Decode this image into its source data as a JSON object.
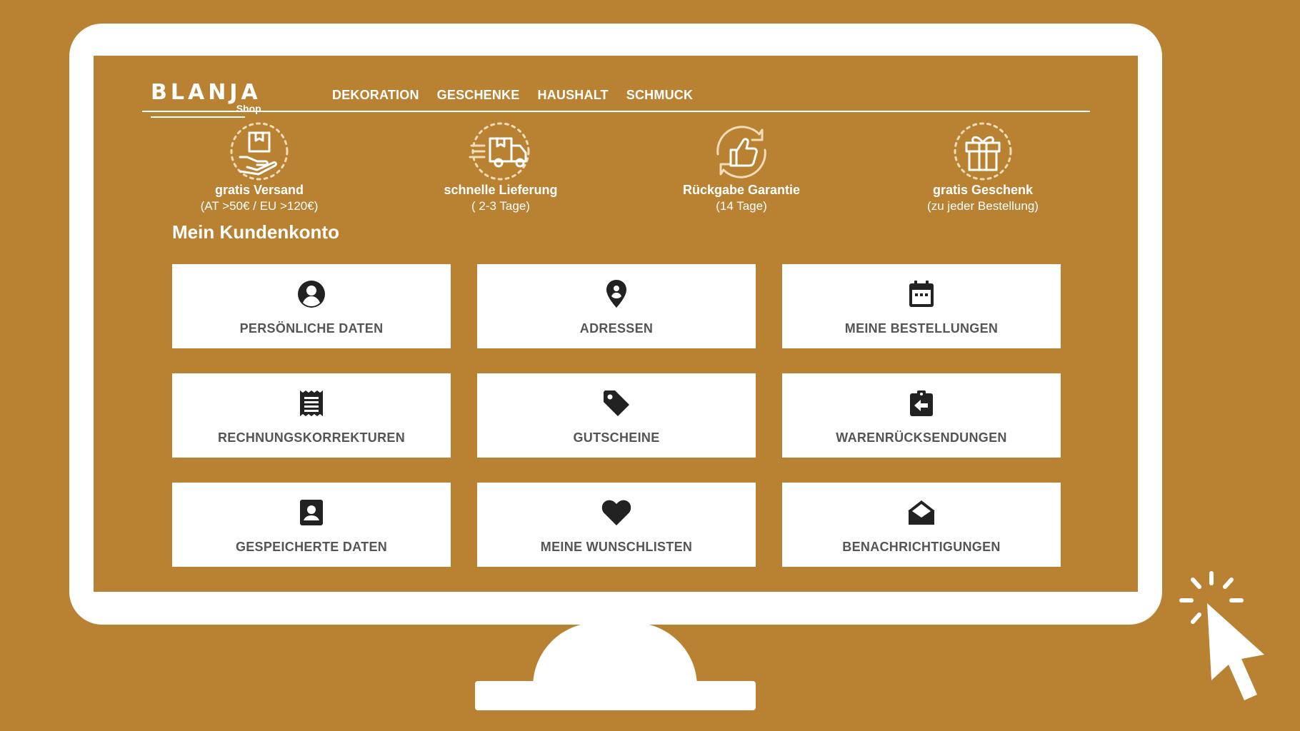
{
  "brand": {
    "name": "BLANJA",
    "sub": "Shop"
  },
  "nav": [
    "DEKORATION",
    "GESCHENKE",
    "HAUSHALT",
    "SCHMUCK"
  ],
  "features": [
    {
      "title": "gratis Versand",
      "sub": "(AT >50€ / EU >120€)",
      "icon": "hand-package-icon"
    },
    {
      "title": "schnelle Lieferung",
      "sub": "( 2-3 Tage)",
      "icon": "delivery-truck-icon"
    },
    {
      "title": "Rückgabe Garantie",
      "sub": "(14 Tage)",
      "icon": "thumbs-up-return-icon"
    },
    {
      "title": "gratis Geschenk",
      "sub": "(zu jeder Bestellung)",
      "icon": "gift-icon"
    }
  ],
  "section_title": "Mein Kundenkonto",
  "cards": [
    {
      "label": "PERSÖNLICHE DATEN",
      "icon": "user-circle-icon"
    },
    {
      "label": "ADRESSEN",
      "icon": "map-pin-icon"
    },
    {
      "label": "MEINE BESTELLUNGEN",
      "icon": "calendar-icon"
    },
    {
      "label": "RECHNUNGSKORREKTUREN",
      "icon": "receipt-icon"
    },
    {
      "label": "GUTSCHEINE",
      "icon": "tag-icon"
    },
    {
      "label": "WARENRÜCKSENDUNGEN",
      "icon": "return-box-icon"
    },
    {
      "label": "GESPEICHERTE DATEN",
      "icon": "contact-card-icon"
    },
    {
      "label": "MEINE WUNSCHLISTEN",
      "icon": "heart-icon"
    },
    {
      "label": "BENACHRICHTIGUNGEN",
      "icon": "open-envelope-icon"
    }
  ],
  "colors": {
    "background": "#b98233",
    "card": "#ffffff",
    "icon": "#222222",
    "label": "#555555"
  }
}
